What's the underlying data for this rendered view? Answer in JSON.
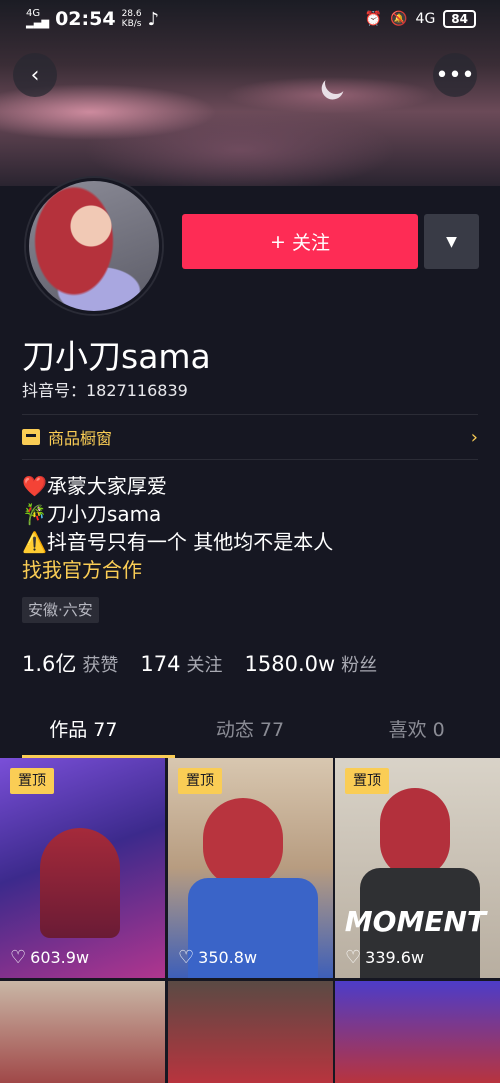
{
  "status_bar": {
    "signal": "4G",
    "time": "02:54",
    "speed_value": "28.6",
    "speed_unit": "KB/s",
    "network": "4G",
    "battery": "84"
  },
  "header": {
    "back_icon": "chevron-left-icon",
    "more_icon": "more-horizontal-icon"
  },
  "profile": {
    "follow_label": "关注",
    "follow_icon": "+",
    "name": "刀小刀sama",
    "douyin_id": "抖音号：1827116839",
    "shop_label": "商品橱窗",
    "bio": [
      "❤️承蒙大家厚爱",
      "🎋刀小刀sama",
      "⚠️抖音号只有一个 其他均不是本人"
    ],
    "bio_link": "找我官方合作",
    "location": "安徽·六安"
  },
  "stats": [
    {
      "value": "1.6亿",
      "label": "获赞"
    },
    {
      "value": "174",
      "label": "关注"
    },
    {
      "value": "1580.0w",
      "label": "粉丝"
    }
  ],
  "tabs": [
    {
      "label": "作品 77",
      "active": true
    },
    {
      "label": "动态 77",
      "active": false
    },
    {
      "label": "喜欢 0",
      "active": false
    }
  ],
  "videos": [
    {
      "pinned": "置顶",
      "likes": "603.9w"
    },
    {
      "pinned": "置顶",
      "likes": "350.8w"
    },
    {
      "pinned": "置顶",
      "likes": "339.6w",
      "overlay": "MOMENT"
    }
  ],
  "colors": {
    "accent_red": "#fe2c55",
    "accent_yellow": "#facd55",
    "background": "#161722"
  }
}
